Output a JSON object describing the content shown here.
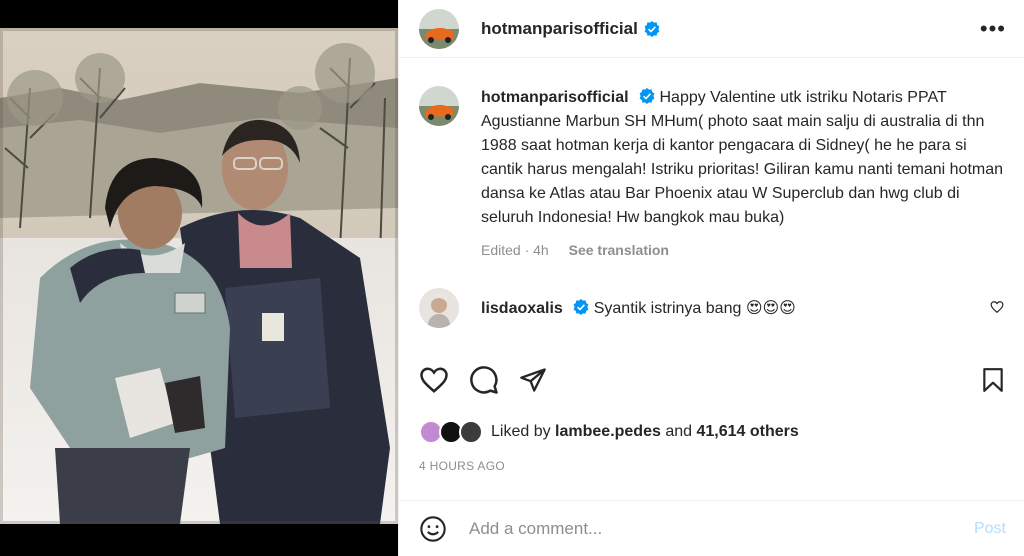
{
  "post": {
    "username": "hotmanparisofficial",
    "caption": "Happy Valentine utk istriku Notaris PPAT Agustianne Marbun SH MHum( photo saat main salju di australia di thn 1988 saat hotman kerja di kantor pengacara di Sidney( he he para si cantik harus mengalah! Istriku prioritas! Giliran kamu nanti temani hotman dansa ke Atlas atau Bar Phoenix atau W Superclub dan hwg club di seluruh Indonesia! Hw bangkok mau buka)",
    "edited": "Edited · 4h",
    "see_translation": "See translation",
    "more_icon": "•••"
  },
  "comment": {
    "username": "lisdaoxalis",
    "text": "Syantik istrinya bang 😍😍😍"
  },
  "likes": {
    "prefix": "Liked by",
    "liker": "lambee.pedes",
    "and": "and",
    "count": "41,614 others"
  },
  "timestamp": "4 HOURS AGO",
  "composer": {
    "placeholder": "Add a comment...",
    "post_label": "Post"
  },
  "colors": {
    "verified": "#0095f6",
    "post_button": "#b2dffc",
    "secondary_text": "#8e8e8e"
  },
  "icons": [
    "heart-icon",
    "comment-icon",
    "share-icon",
    "bookmark-icon",
    "emoji-icon",
    "verified-badge-icon",
    "more-options-icon"
  ]
}
